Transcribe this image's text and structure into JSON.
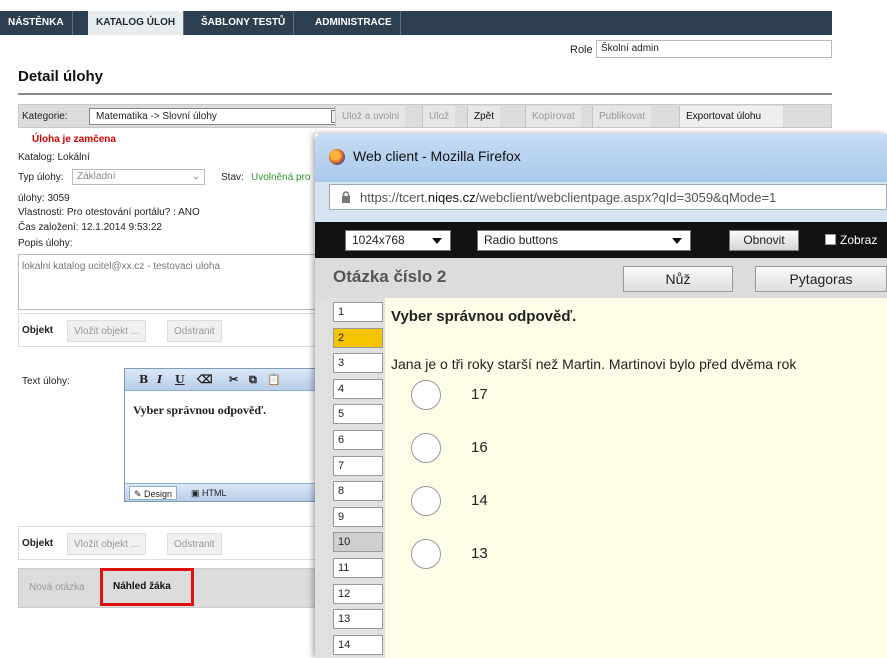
{
  "nav": {
    "tabs": [
      {
        "label": "NÁSTĚNKA",
        "active": false
      },
      {
        "label": "KATALOG ÚLOH",
        "active": true
      },
      {
        "label": "ŠABLONY TESTŮ",
        "active": false
      },
      {
        "label": "ADMINISTRACE",
        "active": false
      }
    ]
  },
  "role": {
    "label": "Role",
    "value": "Školní admin"
  },
  "page_title": "Detail úlohy",
  "toolbar": {
    "category_label": "Kategorie:",
    "category_value": "Matematika -> Slovní úlohy",
    "buttons": [
      "Ulož a uvolni",
      "Ulož",
      "Zpět",
      "Kopírovat",
      "Publikovat",
      "Exportovat úlohu"
    ]
  },
  "task": {
    "locked": "Úloha je zamčena",
    "katalog": "Katalog: Lokální",
    "typ_label": "Typ úlohy:",
    "typ_value": "Základní",
    "stav_label": "Stav:",
    "stav_value": "Uvolněná pro",
    "id": "úlohy: 3059",
    "vlastnosti": "Vlastnosti: Pro otestování portálu? : ANO",
    "cas": "Čas založení: 12.1.2014 9:53:22",
    "popis_label": "Popis úlohy:",
    "popis_value": "lokalni katalog ucitel@xx.cz - testovaci uloha"
  },
  "objekt": {
    "label": "Objekt",
    "insert": "Vložit objekt ...",
    "remove": "Odstranit"
  },
  "editor": {
    "label": "Text úlohy:",
    "content": "Vyber správnou odpověď.",
    "mode_design": "Design",
    "mode_html": "HTML"
  },
  "bottom": {
    "new_question": "Nová otázka",
    "preview": "Náhled žáka"
  },
  "firefox": {
    "title": "Web client - Mozilla Firefox",
    "url_prefix": "https://tcert.",
    "url_domain": "niqes.cz",
    "url_rest": "/webclient/webclientpage.aspx?qId=3059&qMode=1",
    "resolution": "1024x768",
    "type": "Radio buttons",
    "refresh": "Obnovit",
    "show": "Zobraz",
    "question_title": "Otázka číslo 2",
    "tool1": "Nůž",
    "tool2": "Pytagoras",
    "question_numbers": [
      "1",
      "2",
      "3",
      "4",
      "5",
      "6",
      "7",
      "8",
      "9",
      "10",
      "11",
      "12",
      "13",
      "14"
    ],
    "current_question": 2,
    "instruction": "Vyber správnou odpověď.",
    "question_text": "Jana je o tři roky starší než Martin. Martinovi bylo před dvěma rok",
    "options": [
      "17",
      "16",
      "14",
      "13"
    ]
  }
}
